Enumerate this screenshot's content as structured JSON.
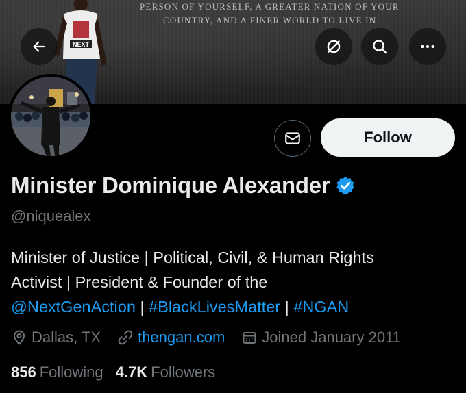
{
  "banner": {
    "line1": "PERSON OF YOURSELF, A GREATER NATION OF YOUR",
    "line2": "COUNTRY, AND A FINER WORLD TO LIVE IN.",
    "shirt_text": "NEXT"
  },
  "header": {
    "back_icon": "arrow-left-icon",
    "sponsor_icon": "slash-circle-icon",
    "search_icon": "search-icon",
    "more_icon": "more-dots-icon"
  },
  "actions": {
    "message_icon": "envelope-icon",
    "follow_label": "Follow"
  },
  "profile": {
    "name": "Minister Dominique Alexander",
    "handle": "@niquealex",
    "bio": {
      "line1": "Minister of Justice | Political, Civil, & Human Rights",
      "line2": "Activist | President & Founder of the",
      "mention": "@NextGenAction",
      "sep1": " | ",
      "hashtag1": "#BlackLivesMatter",
      "sep2": " | ",
      "hashtag2": "#NGAN"
    },
    "location": "Dallas, TX",
    "website": "thengan.com",
    "joined": "Joined January 2011",
    "following_count": "856",
    "following_label": "Following",
    "followers_count": "4.7K",
    "followers_label": "Followers"
  },
  "colors": {
    "background": "#000000",
    "primary_text": "#e7e9ea",
    "secondary_text": "#71767b",
    "link": "#1d9bf0",
    "verified": "#1d9bf0",
    "follow_bg": "#eff3f4"
  }
}
